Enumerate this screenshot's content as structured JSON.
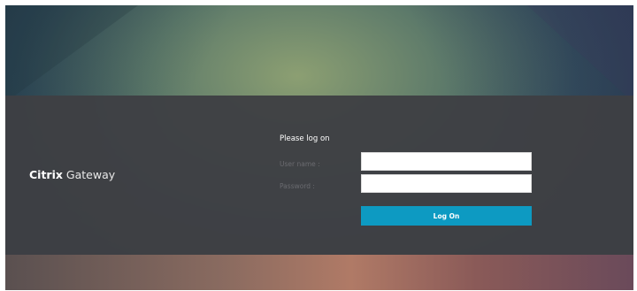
{
  "brand": {
    "bold": "Citrix",
    "light": " Gateway"
  },
  "form": {
    "title": "Please log on",
    "username_label": "User name :",
    "username_value": "",
    "password_label": "Password :",
    "password_value": "",
    "submit_label": "Log On"
  },
  "colors": {
    "band": "#3e3f44",
    "button": "#0d9ac2",
    "input_bg": "#ffffff",
    "label_text": "#6a6b70",
    "title_text": "#ffffff"
  }
}
